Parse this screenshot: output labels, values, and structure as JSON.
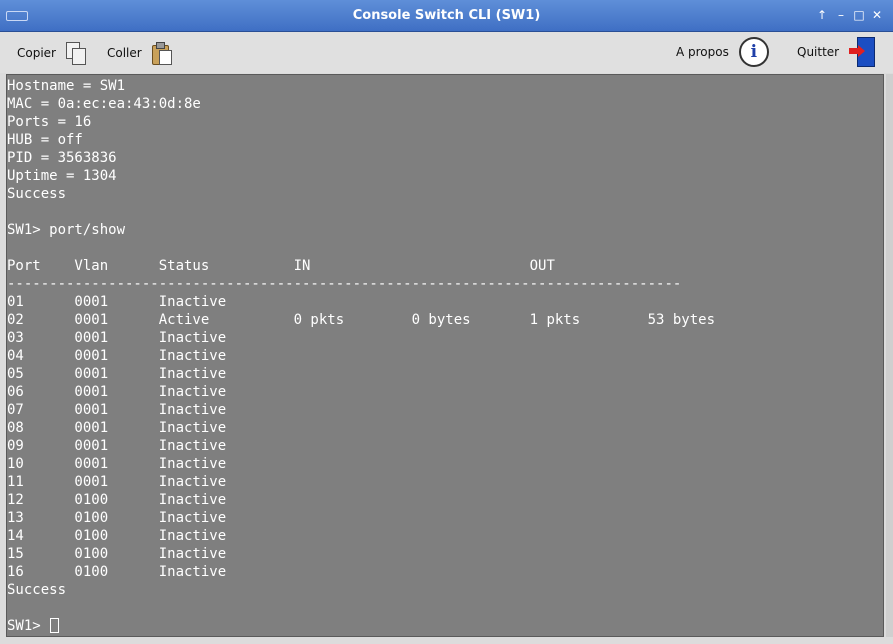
{
  "window": {
    "title": "Console Switch CLI (SW1)",
    "controls": [
      "↑",
      "–",
      "□",
      "✕"
    ]
  },
  "toolbar": {
    "copy_label": "Copier",
    "paste_label": "Coller",
    "about_label": "A propos",
    "quit_label": "Quitter",
    "icons": {
      "copy": "copy-icon",
      "paste": "paste-icon",
      "about": "info-icon",
      "quit": "exit-door-icon"
    }
  },
  "console": {
    "prompt": "SW1> ",
    "lines": [
      "Hostname = SW1",
      "MAC = 0a:ec:ea:43:0d:8e",
      "Ports = 16",
      "HUB = off",
      "PID = 3563836",
      "Uptime = 1304",
      "Success",
      "",
      "SW1> port/show",
      "",
      "Port    Vlan      Status          IN                          OUT",
      "--------------------------------------------------------------------------------",
      "01      0001      Inactive",
      "02      0001      Active          0 pkts        0 bytes       1 pkts        53 bytes",
      "03      0001      Inactive",
      "04      0001      Inactive",
      "05      0001      Inactive",
      "06      0001      Inactive",
      "07      0001      Inactive",
      "08      0001      Inactive",
      "09      0001      Inactive",
      "10      0001      Inactive",
      "11      0001      Inactive",
      "12      0100      Inactive",
      "13      0100      Inactive",
      "14      0100      Inactive",
      "15      0100      Inactive",
      "16      0100      Inactive",
      "Success",
      ""
    ]
  },
  "colors": {
    "titlebar": "#4a7bd0",
    "console_bg": "#7f7f7f",
    "console_text": "#ffffff"
  }
}
